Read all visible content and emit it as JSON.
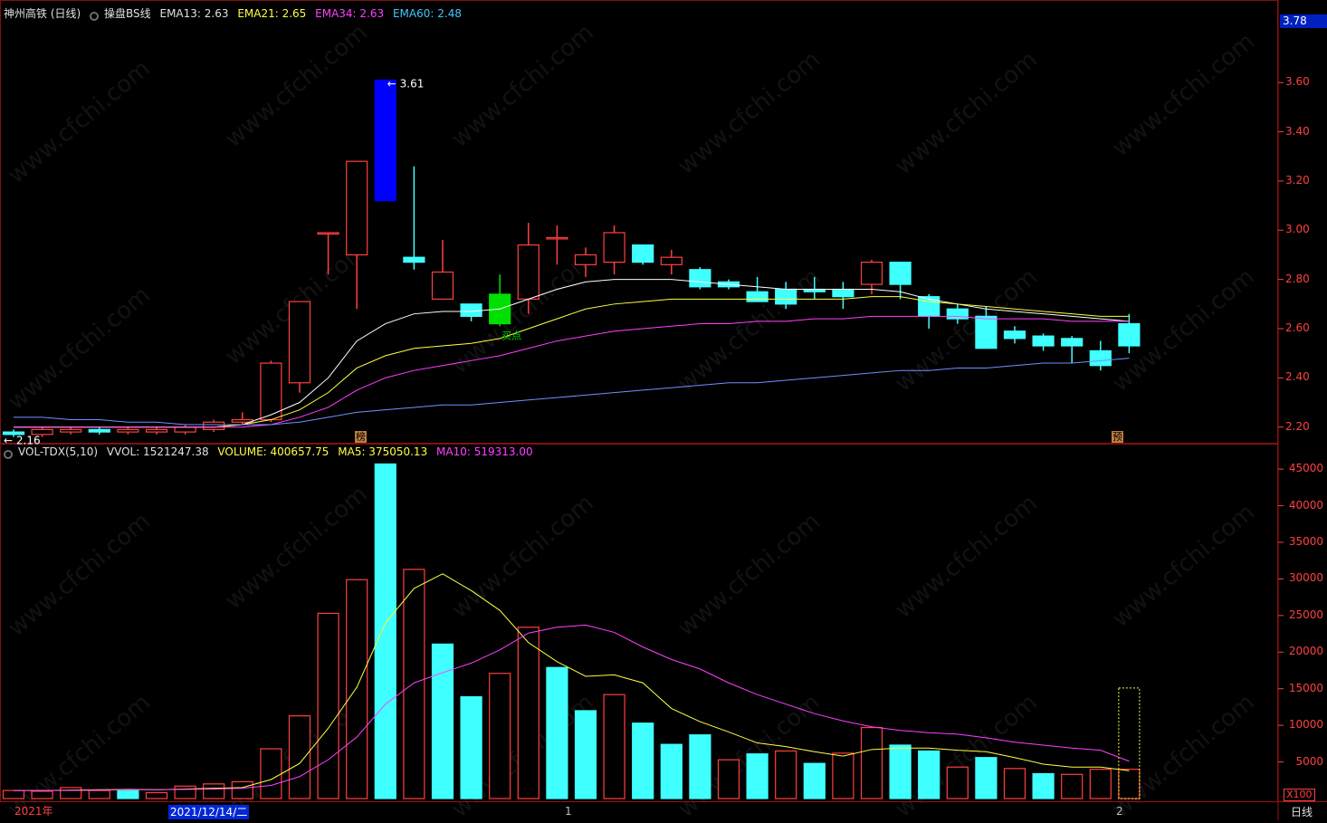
{
  "header": {
    "stock_name": "神州高铁 (日线)",
    "indicator_name": "操盘BS线",
    "ema13_label": "EMA13: 2.63",
    "ema21_label": "EMA21: 2.65",
    "ema34_label": "EMA34: 2.63",
    "ema60_label": "EMA60: 2.48"
  },
  "volume_header": {
    "indicator_name": "VOL-TDX(5,10)",
    "vvol_label": "VVOL: 1521247.38",
    "volume_label": "VOLUME: 400657.75",
    "ma5_label": "MA5: 375050.13",
    "ma10_label": "MA10: 519313.00"
  },
  "current_price_tag": "3.78",
  "high_marker": "3.61",
  "low_marker": "2.16",
  "buy_marker": "买点",
  "event_marks": [
    "榜",
    "预"
  ],
  "x_axis": {
    "year_label": "2021年",
    "selected_date": "2021/12/14/二",
    "tick_1": "1",
    "tick_2": "2",
    "period": "日线",
    "volume_unit": "X100"
  },
  "watermark": "www.cfchi.com",
  "colors": {
    "up": "#ff4040",
    "down": "#40ffff",
    "highlight_down": "#0000ff",
    "buy": "#00e000",
    "ema13": "#ffffff",
    "ema21": "#ffff40",
    "ema34": "#ff40ff",
    "ema60": "#7090ff"
  },
  "chart_data": [
    {
      "type": "candlestick",
      "y_ticks": [
        2.2,
        2.4,
        2.6,
        2.8,
        3.0,
        3.2,
        3.4,
        3.6
      ],
      "ylim": [
        2.14,
        3.84
      ],
      "candles": [
        {
          "o": 2.18,
          "c": 2.17,
          "h": 2.19,
          "l": 2.16
        },
        {
          "o": 2.17,
          "c": 2.19,
          "h": 2.2,
          "l": 2.16
        },
        {
          "o": 2.18,
          "c": 2.19,
          "h": 2.2,
          "l": 2.17
        },
        {
          "o": 2.19,
          "c": 2.18,
          "h": 2.2,
          "l": 2.17
        },
        {
          "o": 2.18,
          "c": 2.19,
          "h": 2.2,
          "l": 2.17
        },
        {
          "o": 2.18,
          "c": 2.19,
          "h": 2.2,
          "l": 2.17
        },
        {
          "o": 2.18,
          "c": 2.2,
          "h": 2.21,
          "l": 2.17
        },
        {
          "o": 2.19,
          "c": 2.22,
          "h": 2.23,
          "l": 2.18
        },
        {
          "o": 2.22,
          "c": 2.23,
          "h": 2.26,
          "l": 2.21
        },
        {
          "o": 2.23,
          "c": 2.46,
          "h": 2.47,
          "l": 2.22
        },
        {
          "o": 2.38,
          "c": 2.71,
          "h": 2.71,
          "l": 2.34
        },
        {
          "o": 2.99,
          "c": 2.99,
          "h": 2.99,
          "l": 2.82
        },
        {
          "o": 2.9,
          "c": 3.28,
          "h": 3.28,
          "l": 2.68
        },
        {
          "o": 3.61,
          "c": 3.12,
          "h": 3.61,
          "l": 3.12
        },
        {
          "o": 2.89,
          "c": 2.87,
          "h": 3.26,
          "l": 2.84
        },
        {
          "o": 2.72,
          "c": 2.83,
          "h": 2.96,
          "l": 2.72
        },
        {
          "o": 2.7,
          "c": 2.65,
          "h": 2.7,
          "l": 2.63
        },
        {
          "o": 2.62,
          "c": 2.74,
          "h": 2.82,
          "l": 2.61
        },
        {
          "o": 2.72,
          "c": 2.94,
          "h": 3.03,
          "l": 2.66
        },
        {
          "o": 2.97,
          "c": 2.97,
          "h": 3.02,
          "l": 2.86
        },
        {
          "o": 2.86,
          "c": 2.9,
          "h": 2.93,
          "l": 2.81
        },
        {
          "o": 2.87,
          "c": 2.99,
          "h": 3.02,
          "l": 2.82
        },
        {
          "o": 2.94,
          "c": 2.87,
          "h": 2.94,
          "l": 2.86
        },
        {
          "o": 2.86,
          "c": 2.89,
          "h": 2.92,
          "l": 2.82
        },
        {
          "o": 2.84,
          "c": 2.77,
          "h": 2.85,
          "l": 2.76
        },
        {
          "o": 2.79,
          "c": 2.77,
          "h": 2.8,
          "l": 2.76
        },
        {
          "o": 2.75,
          "c": 2.71,
          "h": 2.81,
          "l": 2.71
        },
        {
          "o": 2.76,
          "c": 2.7,
          "h": 2.79,
          "l": 2.68
        },
        {
          "o": 2.76,
          "c": 2.75,
          "h": 2.81,
          "l": 2.72
        },
        {
          "o": 2.76,
          "c": 2.73,
          "h": 2.79,
          "l": 2.68
        },
        {
          "o": 2.78,
          "c": 2.87,
          "h": 2.88,
          "l": 2.74
        },
        {
          "o": 2.87,
          "c": 2.78,
          "h": 2.87,
          "l": 2.72
        },
        {
          "o": 2.73,
          "c": 2.65,
          "h": 2.74,
          "l": 2.6
        },
        {
          "o": 2.68,
          "c": 2.64,
          "h": 2.7,
          "l": 2.62
        },
        {
          "o": 2.65,
          "c": 2.52,
          "h": 2.69,
          "l": 2.52
        },
        {
          "o": 2.59,
          "c": 2.56,
          "h": 2.61,
          "l": 2.54
        },
        {
          "o": 2.57,
          "c": 2.53,
          "h": 2.58,
          "l": 2.51
        },
        {
          "o": 2.56,
          "c": 2.53,
          "h": 2.57,
          "l": 2.46
        },
        {
          "o": 2.51,
          "c": 2.45,
          "h": 2.55,
          "l": 2.43
        },
        {
          "o": 2.62,
          "c": 2.53,
          "h": 2.66,
          "l": 2.5
        }
      ],
      "series": [
        {
          "name": "EMA13",
          "values": [
            2.2,
            2.2,
            2.2,
            2.2,
            2.2,
            2.2,
            2.2,
            2.2,
            2.21,
            2.25,
            2.3,
            2.4,
            2.55,
            2.62,
            2.66,
            2.67,
            2.67,
            2.68,
            2.72,
            2.76,
            2.79,
            2.8,
            2.8,
            2.8,
            2.79,
            2.78,
            2.77,
            2.76,
            2.76,
            2.76,
            2.76,
            2.75,
            2.72,
            2.7,
            2.68,
            2.67,
            2.66,
            2.65,
            2.64,
            2.63
          ]
        },
        {
          "name": "EMA21",
          "values": [
            2.2,
            2.2,
            2.2,
            2.2,
            2.2,
            2.2,
            2.2,
            2.2,
            2.21,
            2.23,
            2.27,
            2.34,
            2.44,
            2.49,
            2.52,
            2.53,
            2.54,
            2.56,
            2.6,
            2.64,
            2.68,
            2.7,
            2.71,
            2.72,
            2.72,
            2.72,
            2.72,
            2.72,
            2.72,
            2.72,
            2.73,
            2.73,
            2.71,
            2.7,
            2.69,
            2.68,
            2.67,
            2.66,
            2.65,
            2.65
          ]
        },
        {
          "name": "EMA34",
          "values": [
            2.2,
            2.2,
            2.2,
            2.2,
            2.2,
            2.2,
            2.2,
            2.2,
            2.2,
            2.21,
            2.24,
            2.28,
            2.35,
            2.4,
            2.43,
            2.45,
            2.47,
            2.49,
            2.52,
            2.55,
            2.57,
            2.59,
            2.6,
            2.61,
            2.62,
            2.62,
            2.63,
            2.63,
            2.64,
            2.64,
            2.65,
            2.65,
            2.65,
            2.65,
            2.64,
            2.64,
            2.64,
            2.63,
            2.63,
            2.63
          ]
        },
        {
          "name": "EMA60",
          "values": [
            2.24,
            2.24,
            2.23,
            2.23,
            2.22,
            2.22,
            2.21,
            2.21,
            2.21,
            2.21,
            2.22,
            2.24,
            2.26,
            2.27,
            2.28,
            2.29,
            2.29,
            2.3,
            2.31,
            2.32,
            2.33,
            2.34,
            2.35,
            2.36,
            2.37,
            2.38,
            2.38,
            2.39,
            2.4,
            2.41,
            2.42,
            2.43,
            2.43,
            2.44,
            2.44,
            2.45,
            2.46,
            2.46,
            2.47,
            2.48
          ]
        }
      ]
    },
    {
      "type": "bar",
      "y_ticks": [
        5000,
        10000,
        15000,
        20000,
        25000,
        30000,
        35000,
        40000,
        45000
      ],
      "ylim": [
        0,
        46500
      ],
      "values": [
        1100,
        1000,
        1500,
        1100,
        1200,
        800,
        1700,
        2000,
        2300,
        6800,
        11300,
        25300,
        29900,
        45700,
        31300,
        21100,
        13900,
        17100,
        23400,
        17900,
        12000,
        14200,
        10300,
        7400,
        8700,
        5300,
        6100,
        6500,
        4800,
        6200,
        9700,
        7300,
        6500,
        4300,
        5600,
        4100,
        3400,
        3300,
        4000,
        4000
      ],
      "up": [
        true,
        true,
        true,
        true,
        false,
        true,
        true,
        true,
        true,
        true,
        true,
        true,
        true,
        false,
        true,
        false,
        false,
        true,
        true,
        false,
        false,
        true,
        false,
        false,
        false,
        true,
        false,
        true,
        false,
        true,
        true,
        false,
        false,
        true,
        false,
        true,
        false,
        true,
        true,
        true
      ],
      "series": [
        {
          "name": "MA5",
          "values": [
            1100,
            1100,
            1150,
            1200,
            1250,
            1200,
            1300,
            1400,
            1500,
            2600,
            4800,
            9600,
            15200,
            24000,
            28700,
            30700,
            28400,
            25700,
            21300,
            18700,
            16700,
            16900,
            15800,
            12300,
            10500,
            9100,
            7600,
            7100,
            6400,
            5800,
            6700,
            6900,
            6900,
            6600,
            6400,
            5600,
            4700,
            4300,
            4300,
            3800
          ]
        },
        {
          "name": "MA10",
          "values": [
            1100,
            1100,
            1100,
            1150,
            1200,
            1200,
            1250,
            1300,
            1400,
            1800,
            3000,
            5300,
            8400,
            12900,
            15800,
            17200,
            18500,
            20300,
            22600,
            23400,
            23700,
            22700,
            20700,
            19000,
            17700,
            15800,
            14200,
            12900,
            11600,
            10600,
            9800,
            9300,
            9000,
            8800,
            8300,
            7700,
            7300,
            6900,
            6600,
            5100
          ]
        }
      ]
    }
  ]
}
